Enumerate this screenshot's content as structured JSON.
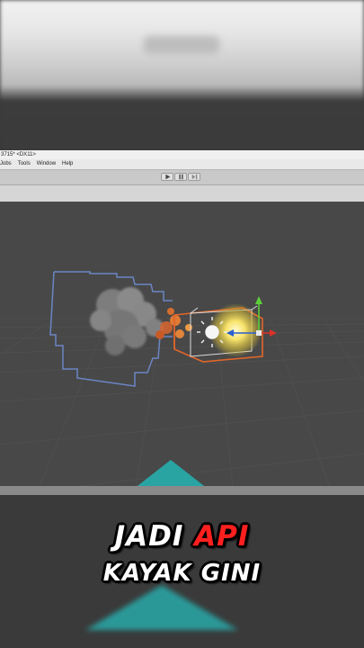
{
  "window": {
    "title": "3715* <DX11>"
  },
  "menu": {
    "items": [
      "Jobs",
      "Tools",
      "Window",
      "Help"
    ]
  },
  "toolbar": {
    "buttons": [
      "play",
      "pause",
      "step"
    ]
  },
  "caption": {
    "line1_part1": "JADI",
    "line1_highlight": "API",
    "line2": "KAYAK GINI",
    "highlight_color": "#ff1f1f"
  },
  "colors": {
    "scene_bg": "#484848",
    "selection_outline": "#e0662a",
    "bounds_outline": "#6b86c4",
    "accent_teal": "#2aa3a3"
  }
}
